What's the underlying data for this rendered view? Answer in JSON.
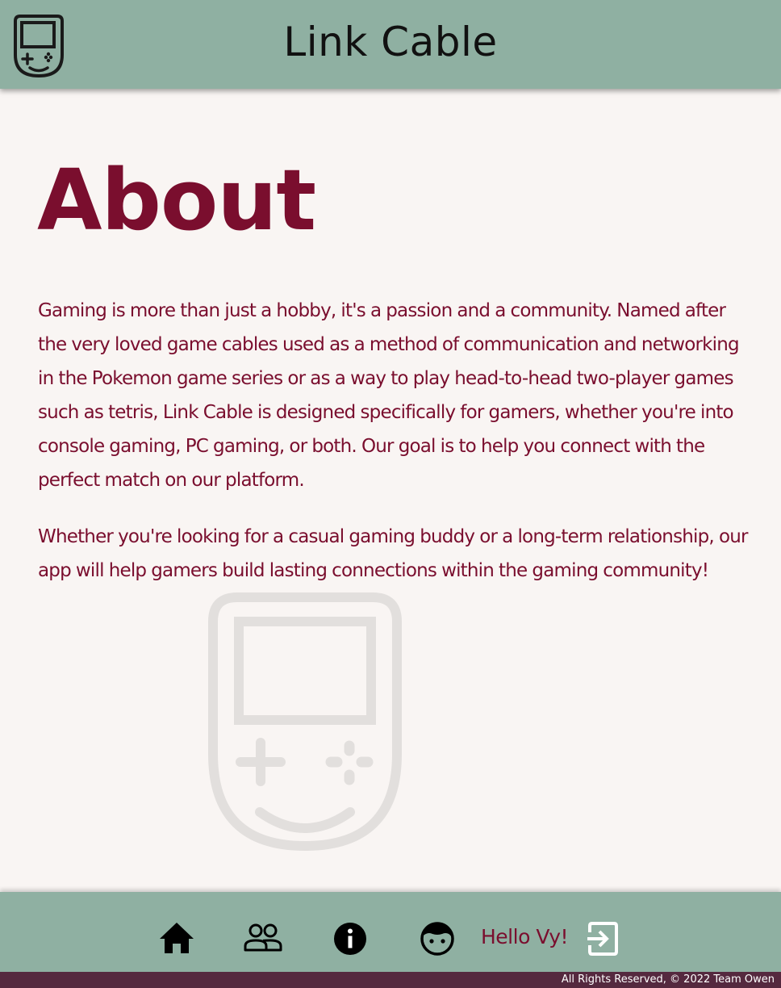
{
  "header": {
    "title": "Link Cable",
    "logo_icon": "handheld-console-icon",
    "background": "#8fb0a2"
  },
  "main": {
    "heading": "About",
    "paragraphs": [
      "Gaming is more than just a hobby, it's a passion and a community. Named after the very loved game cables used as a method of communication and networking in the Pokemon game series or as a way to play head-to-head two-player games such as tetris, Link Cable is designed specifically for gamers, whether you're into console gaming, PC gaming, or both. Our goal is to help you connect with the perfect match on our platform.",
      "Whether you're looking for a casual gaming buddy or a long-term relationship, our app will help gamers build lasting connections within the gaming community!"
    ],
    "watermark_icon": "handheld-console-icon",
    "text_color": "#7a0e2e"
  },
  "nav": {
    "items": [
      {
        "icon": "home-icon"
      },
      {
        "icon": "people-icon"
      },
      {
        "icon": "info-icon"
      },
      {
        "icon": "face-icon"
      }
    ],
    "greeting": "Hello Vy!",
    "logout_icon": "logout-icon"
  },
  "footer": {
    "copyright": "All Rights Reserved, © 2022 Team Owen",
    "background": "#55293f"
  }
}
